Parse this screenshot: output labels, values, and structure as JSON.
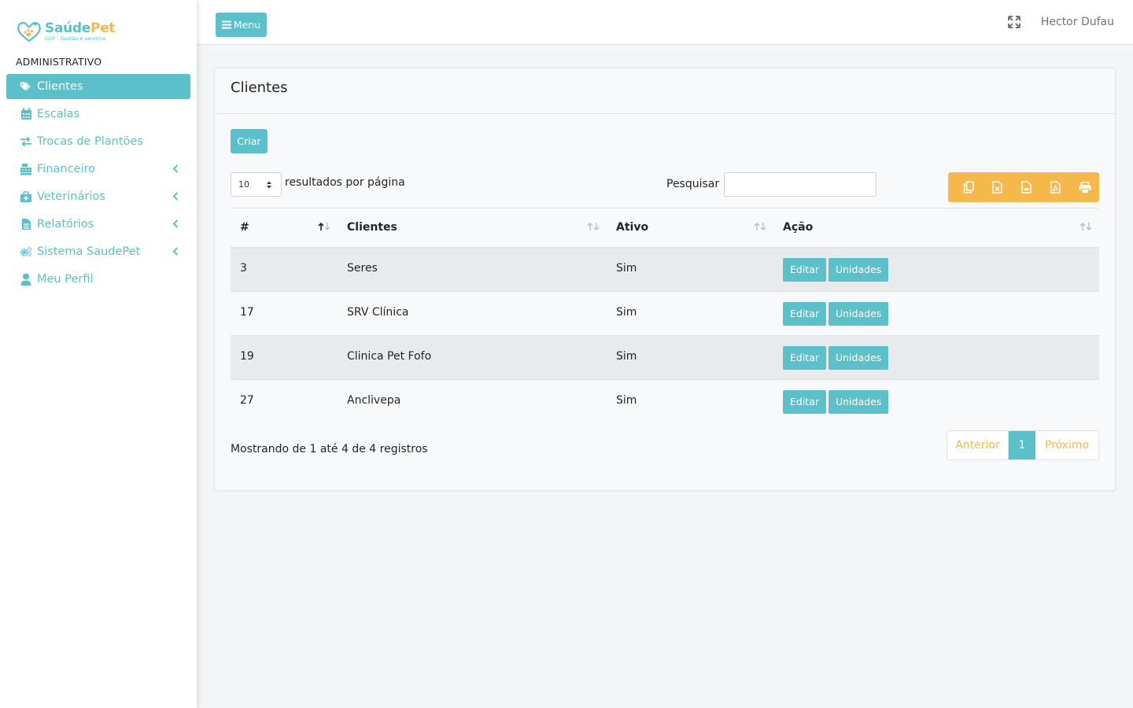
{
  "brand": {
    "name_part1": "Saúde",
    "name_part2": "Pet",
    "tagline": "GSP - Gestão e serviços"
  },
  "sidebar": {
    "section_header": "ADMINISTRATIVO",
    "items": [
      {
        "label": "Clientes",
        "icon": "tags-icon",
        "active": true
      },
      {
        "label": "Escalas",
        "icon": "calendar-icon"
      },
      {
        "label": "Trocas de Plantões",
        "icon": "exchange-icon"
      },
      {
        "label": "Financeiro",
        "icon": "cash-register-icon",
        "submenu": true
      },
      {
        "label": "Veterinários",
        "icon": "medkit-icon",
        "submenu": true
      },
      {
        "label": "Relatórios",
        "icon": "file-icon",
        "submenu": true
      },
      {
        "label": "Sistema SaudePet",
        "icon": "cogs-icon",
        "submenu": true
      },
      {
        "label": "Meu Perfil",
        "icon": "user-icon"
      }
    ]
  },
  "topbar": {
    "menu_label": "Menu",
    "user_name": "Hector Dufau"
  },
  "card": {
    "title": "Clientes",
    "create_label": "Criar",
    "page_length": "10",
    "page_length_label": "resultados por página",
    "search_label": "Pesquisar",
    "search_value": ""
  },
  "table": {
    "columns": [
      "#",
      "Clientes",
      "Ativo",
      "Ação"
    ],
    "rows": [
      {
        "id": "3",
        "name": "Seres",
        "active": "Sim",
        "edit": "Editar",
        "units": "Unidades"
      },
      {
        "id": "17",
        "name": "SRV Clínica",
        "active": "Sim",
        "edit": "Editar",
        "units": "Unidades"
      },
      {
        "id": "19",
        "name": "Clinica Pet Fofo",
        "active": "Sim",
        "edit": "Editar",
        "units": "Unidades"
      },
      {
        "id": "27",
        "name": "Anclivepa",
        "active": "Sim",
        "edit": "Editar",
        "units": "Unidades"
      }
    ]
  },
  "footer": {
    "info": "Mostrando de 1 até 4 de 4 registros",
    "prev": "Anterior",
    "current_page": "1",
    "next": "Próximo"
  },
  "colors": {
    "primary": "#5bc0c9",
    "warning": "#f7b84b"
  }
}
